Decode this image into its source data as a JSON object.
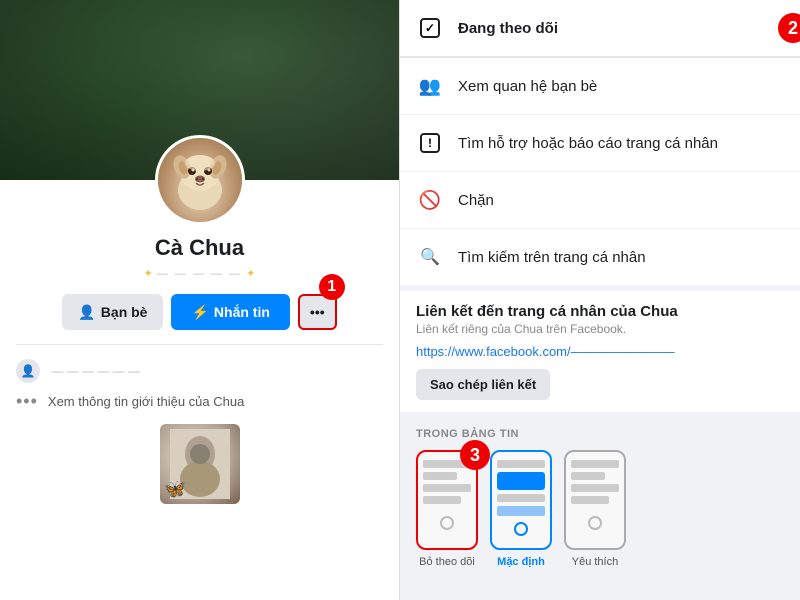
{
  "left": {
    "profile_name": "Cà Chua",
    "tagline_prefix": "✦",
    "tagline_text": "— — — — — ✦",
    "btn_friend": "Bạn bè",
    "btn_message": "Nhắn tin",
    "btn_more_dots": "•••",
    "number_label_1": "1",
    "info_blur": "‎‎‎ — — — — — —",
    "see_intro": "Xem thông tin giới thiệu của Chua"
  },
  "right": {
    "following_label": "Đang theo dõi",
    "number_label_2": "2",
    "menu_items": [
      {
        "icon": "check-box",
        "text": "Đang theo dõi"
      },
      {
        "icon": "people",
        "text": "Xem quan hệ bạn bè"
      },
      {
        "icon": "warning",
        "text": "Tìm hỗ trợ hoặc báo cáo trang cá nhân"
      },
      {
        "icon": "block",
        "text": "Chặn"
      },
      {
        "icon": "search",
        "text": "Tìm kiếm trên trang cá nhân"
      }
    ],
    "link_title": "Liên kết đến trang cá nhân của Chua",
    "link_subtitle": "Liên kết riêng của Chua trên Facebook.",
    "link_url": "https://www.facebook.com/————————",
    "copy_btn": "Sao chép liên kết",
    "feed_label": "TRONG BẢNG TIN",
    "number_label_3": "3",
    "feed_options": [
      {
        "label": "Bỏ theo dõi",
        "style": "default",
        "red_border": true
      },
      {
        "label": "Mặc định",
        "style": "blue"
      },
      {
        "label": "Yêu thích",
        "style": "default"
      }
    ]
  }
}
